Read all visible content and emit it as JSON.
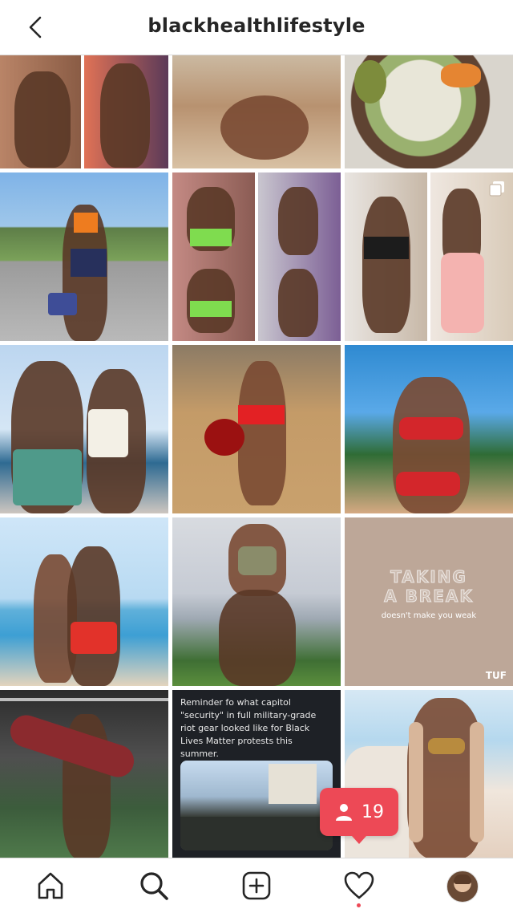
{
  "header": {
    "title": "blackhealthlifestyle"
  },
  "tiles": {
    "break": {
      "title_line1": "TAKING",
      "title_line2": "A BREAK",
      "subtitle": "doesn't make you weak",
      "brand": "TUF"
    },
    "tweet": {
      "text": "Reminder fo what capitol \"security\" in full military-grade riot gear looked like for Black Lives Matter protests this summer."
    }
  },
  "notification": {
    "icon": "person-icon",
    "count": "19"
  },
  "bottom_nav": {
    "items": [
      "home-icon",
      "search-icon",
      "add-post-icon",
      "heart-icon",
      "profile-avatar"
    ]
  },
  "colors": {
    "notification": "#ed4956",
    "text": "#262626",
    "divider": "#dbdbdb"
  }
}
